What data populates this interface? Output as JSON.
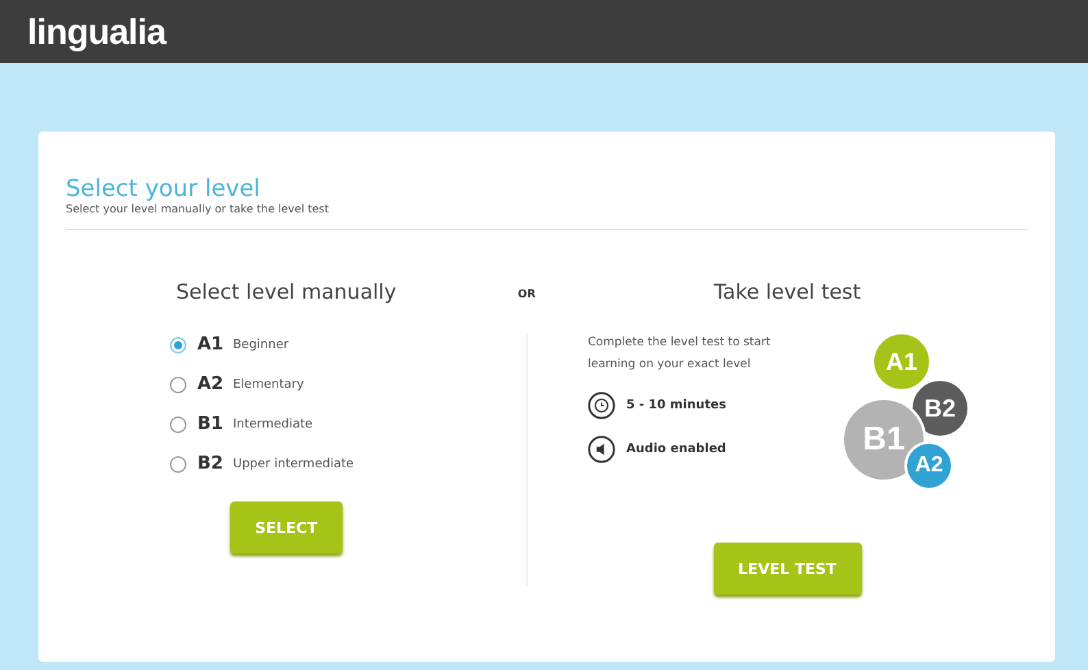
{
  "header": {
    "logo": "lingualia"
  },
  "panel": {
    "title": "Select your level",
    "subtitle": "Select your level manually or take the level test"
  },
  "manual": {
    "heading": "Select level manually",
    "levels": [
      {
        "code": "A1",
        "name": "Beginner",
        "selected": true
      },
      {
        "code": "A2",
        "name": "Elementary",
        "selected": false
      },
      {
        "code": "B1",
        "name": "Intermediate",
        "selected": false
      },
      {
        "code": "B2",
        "name": "Upper intermediate",
        "selected": false
      }
    ],
    "button": "SELECT"
  },
  "separator": "OR",
  "test": {
    "heading": "Take level test",
    "description": "Complete the level test to start learning on your exact level",
    "features": [
      {
        "kind": "clock",
        "text": "5 - 10 minutes"
      },
      {
        "kind": "audio",
        "text": "Audio enabled"
      }
    ],
    "bubbles": [
      {
        "label": "A1",
        "color": "#a6c418"
      },
      {
        "label": "B2",
        "color": "#5c5c5c"
      },
      {
        "label": "B1",
        "color": "#b3b3b3"
      },
      {
        "label": "A2",
        "color": "#2fa3d3"
      }
    ],
    "button": "LEVEL TEST"
  }
}
